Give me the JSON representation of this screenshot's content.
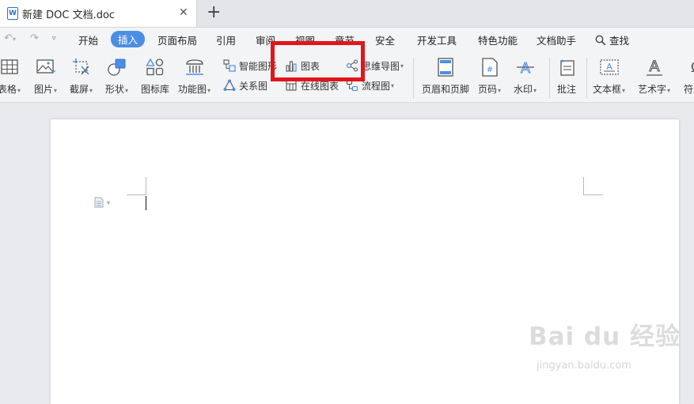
{
  "tab": {
    "title": "新建 DOC 文档.doc",
    "doc_icon": "W",
    "close": "✕",
    "new_tab": "+"
  },
  "menu": {
    "items": [
      "开始",
      "插入",
      "页面布局",
      "引用",
      "审阅",
      "视图",
      "章节",
      "安全",
      "开发工具",
      "特色功能",
      "文档助手"
    ],
    "active": "插入",
    "search": "查找"
  },
  "ribbon": {
    "table": "表格",
    "picture": "图片",
    "screenshot": "截屏",
    "shape": "形状",
    "icon_library": "图标库",
    "function_chart": "功能图",
    "smart_graphic": "智能图形",
    "relation_chart": "关系图",
    "chart": "图表",
    "online_chart": "在线图表",
    "mind_map": "思维导图",
    "flowchart": "流程图",
    "header_footer": "页眉和页脚",
    "page_number": "页码",
    "watermark": "水印",
    "comment": "批注",
    "text_box": "文本框",
    "word_art": "艺术字",
    "symbol": "符"
  },
  "colors": {
    "accent": "#4b8ee6",
    "highlight": "#e0161b",
    "doc_blue": "#2f6fd6"
  },
  "watermark": {
    "brand": "Bai du 经验",
    "url": "jingyan.baidu.com"
  }
}
